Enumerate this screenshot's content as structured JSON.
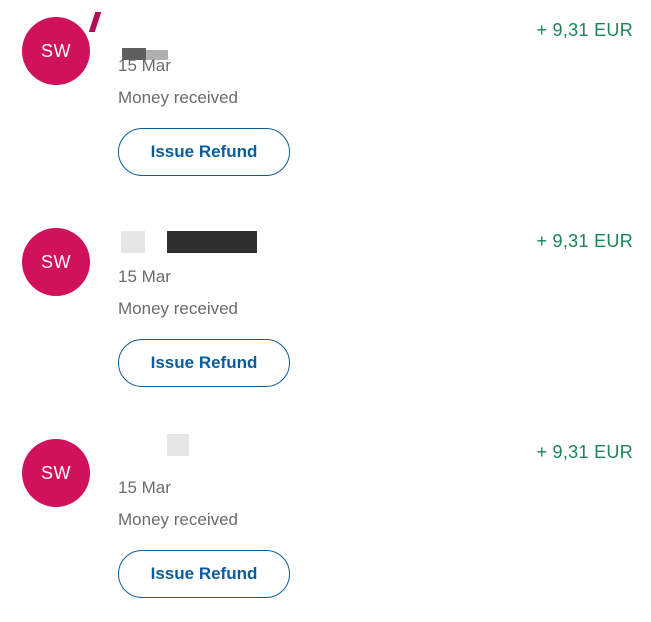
{
  "colors": {
    "avatar_bg": "#d0115c",
    "amount_positive": "#1b8457",
    "button_accent": "#0a5c9a",
    "muted_text": "#6b6b6b"
  },
  "transactions": [
    {
      "initials": "SW",
      "date": "15 Mar",
      "status": "Money received",
      "amount": "+ 9,31 EUR",
      "action_label": "Issue Refund"
    },
    {
      "initials": "SW",
      "date": "15 Mar",
      "status": "Money received",
      "amount": "+ 9,31 EUR",
      "action_label": "Issue Refund"
    },
    {
      "initials": "SW",
      "date": "15 Mar",
      "status": "Money received",
      "amount": "+ 9,31 EUR",
      "action_label": "Issue Refund"
    }
  ]
}
